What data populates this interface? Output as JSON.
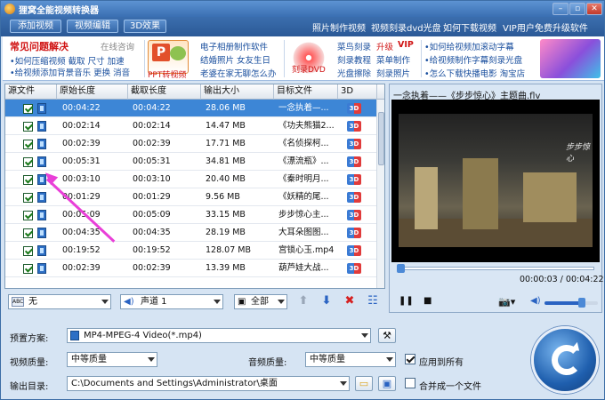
{
  "window": {
    "title": "狸窝全能视频转换器"
  },
  "toolbar": {
    "add_video": "添加视频",
    "edit_video": "视频编辑",
    "effect_3d": "3D效果"
  },
  "top_links": [
    "照片制作视频",
    "视频刻录dvd光盘",
    "如何下载视频",
    "VIP用户免费升级软件"
  ],
  "ad": {
    "faq_title": "常见问题解决",
    "online_consult": "在线咨询",
    "faq_line1": "•如何压缩视频  截取  尺寸  加速",
    "faq_line2": "•给视频添加背景音乐  更换  消音",
    "ppt_label": "PPT转视频",
    "col2": [
      "电子相册制作软件",
      "结婚照片  女友生日",
      "老婆在家无聊怎么办"
    ],
    "dvd_label": "刻录DVD",
    "col3a": [
      "菜鸟刻录",
      "刻录教程",
      "光盘擦除"
    ],
    "col3b_first": "升级",
    "col3b_vip": "VIP",
    "col3b": [
      "菜单制作",
      "刻录照片"
    ],
    "col4": [
      "•如何给视频加滚动字幕",
      "•给视频制作字幕刻录光盘",
      "•怎么下载快播电影  淘宝店"
    ]
  },
  "table": {
    "headers": [
      "源文件",
      "原始长度",
      "截取长度",
      "输出大小",
      "目标文件",
      "3D"
    ],
    "rows": [
      {
        "orig": "00:04:22",
        "cut": "00:04:22",
        "size": "28.06 MB",
        "target": "一念执着—...",
        "selected": true
      },
      {
        "orig": "00:02:14",
        "cut": "00:02:14",
        "size": "14.47 MB",
        "target": "《功夫熊猫2...",
        "selected": false
      },
      {
        "orig": "00:02:39",
        "cut": "00:02:39",
        "size": "17.71 MB",
        "target": "《名侦探柯...",
        "selected": false
      },
      {
        "orig": "00:05:31",
        "cut": "00:05:31",
        "size": "34.81 MB",
        "target": "《漂流瓶》...",
        "selected": false
      },
      {
        "orig": "00:03:10",
        "cut": "00:03:10",
        "size": "20.40 MB",
        "target": "《秦时明月...",
        "selected": false
      },
      {
        "orig": "00:01:29",
        "cut": "00:01:29",
        "size": "9.56 MB",
        "target": "《妖精的尾...",
        "selected": false
      },
      {
        "orig": "00:05:09",
        "cut": "00:05:09",
        "size": "33.15 MB",
        "target": "步步惊心主...",
        "selected": false
      },
      {
        "orig": "00:04:35",
        "cut": "00:04:35",
        "size": "28.19 MB",
        "target": "大耳朵图图...",
        "selected": false
      },
      {
        "orig": "00:19:52",
        "cut": "00:19:52",
        "size": "128.07 MB",
        "target": "宫锁心玉.mp4",
        "selected": false
      },
      {
        "orig": "00:02:39",
        "cut": "00:02:39",
        "size": "13.39 MB",
        "target": "葫芦娃大战...",
        "selected": false
      }
    ],
    "badge_3d": "3D"
  },
  "preview": {
    "title": "一念执着——《步步惊心》主题曲.flv",
    "watermark": "步步惊心",
    "time": "00:00:03 / 00:04:22",
    "progress": 0.011,
    "volume": 0.7
  },
  "controls": {
    "subtitle": "无",
    "audio": "声道 1",
    "audio_all": "全部"
  },
  "settings": {
    "preset_label": "预置方案:",
    "preset_value": "MP4-MPEG-4 Video(*.mp4)",
    "video_quality_label": "视频质量:",
    "video_quality_value": "中等质量",
    "audio_quality_label": "音频质量:",
    "audio_quality_value": "中等质量",
    "apply_all_label": "应用到所有",
    "output_label": "输出目录:",
    "output_value": "C:\\Documents and Settings\\Administrator\\桌面",
    "merge_label": "合并成一个文件"
  }
}
